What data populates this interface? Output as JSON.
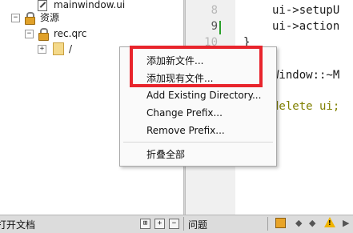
{
  "tree": {
    "mainwindow_ui": "mainwindow.ui",
    "resources_label": "资源",
    "qrc_label": "rec.qrc",
    "prefix_label": "/"
  },
  "editor": {
    "line_numbers": [
      "8",
      "9",
      "10"
    ],
    "lines": [
      "ui->setupU",
      "ui->action",
      "}",
      "Window::~M",
      "delete ui;"
    ]
  },
  "context_menu": {
    "items": [
      "添加新文件...",
      "添加现有文件...",
      "Add Existing Directory...",
      "Change Prefix...",
      "Remove Prefix...",
      "折叠全部"
    ]
  },
  "bottom_bar": {
    "open_docs": "打开文档",
    "issues": "问题"
  },
  "colors": {
    "highlight_box": "#e8242c",
    "keyword": "#808000"
  }
}
